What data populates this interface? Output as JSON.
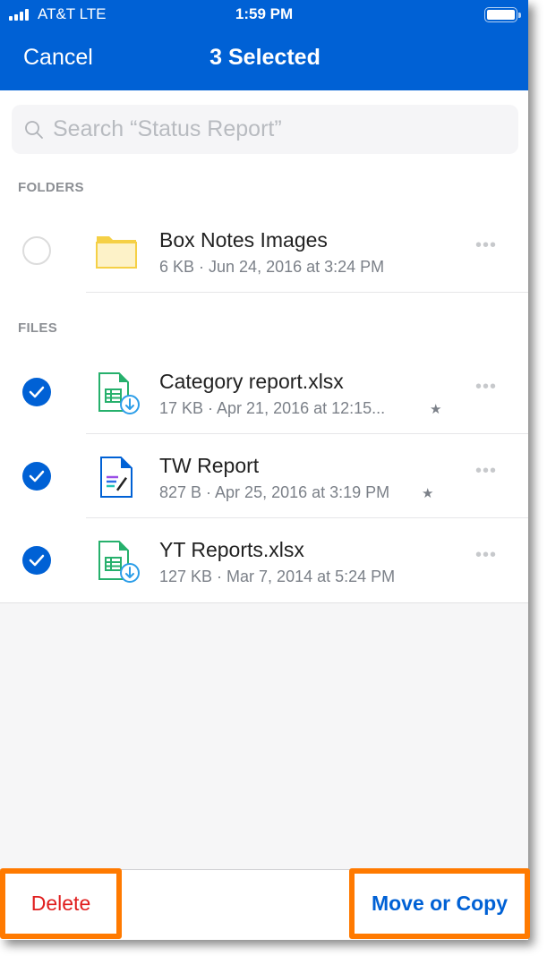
{
  "status_bar": {
    "carrier": "AT&T  LTE",
    "time": "1:59 PM",
    "signal_bars": 4,
    "battery_level": 1.0
  },
  "header": {
    "cancel_label": "Cancel",
    "title": "3 Selected",
    "brand_color": "#0061d5"
  },
  "search": {
    "placeholder": "Search “Status Report”",
    "value": ""
  },
  "sections": {
    "folders_label": "FOLDERS",
    "files_label": "FILES"
  },
  "folders": [
    {
      "name": "Box Notes Images",
      "meta": "6 KB · Jun 24, 2016 at 3:24 PM",
      "selected": false,
      "icon": "folder-icon",
      "starred": false,
      "more": "•••"
    }
  ],
  "files": [
    {
      "name": "Category report.xlsx",
      "meta": "17 KB · Apr 21, 2016 at 12:15...",
      "selected": true,
      "icon": "spreadsheet-offline-icon",
      "starred": true,
      "star": "★",
      "more": "•••"
    },
    {
      "name": "TW Report",
      "meta": "827 B · Apr 25, 2016 at 3:19 PM",
      "selected": true,
      "icon": "box-note-icon",
      "starred": true,
      "star": "★",
      "more": "•••"
    },
    {
      "name": "YT Reports.xlsx",
      "meta": "127 KB · Mar 7, 2014 at 5:24 PM",
      "selected": true,
      "icon": "spreadsheet-offline-icon",
      "starred": false,
      "more": "•••"
    }
  ],
  "toolbar": {
    "delete_label": "Delete",
    "move_copy_label": "Move or Copy",
    "delete_color": "#e01e1e",
    "highlight_color": "#ff7a00"
  }
}
